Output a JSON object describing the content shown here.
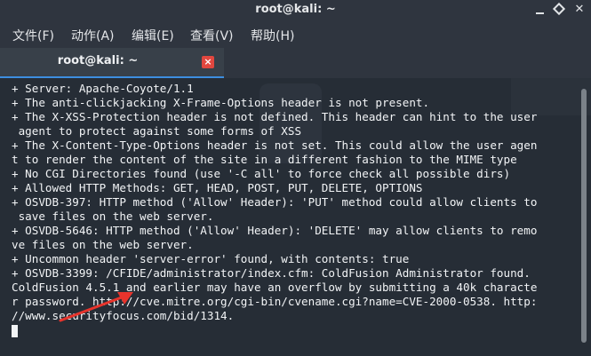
{
  "window": {
    "title": "root@kali: ~"
  },
  "menu": [
    {
      "label": "文件(F)"
    },
    {
      "label": "动作(A)"
    },
    {
      "label": "编辑(E)"
    },
    {
      "label": "查看(V)"
    },
    {
      "label": "帮助(H)"
    }
  ],
  "tab": {
    "label": "root@kali: ~",
    "close_glyph": "×"
  },
  "terminal": {
    "lines": [
      "+ Server: Apache-Coyote/1.1",
      "+ The anti-clickjacking X-Frame-Options header is not present.",
      "+ The X-XSS-Protection header is not defined. This header can hint to the user",
      " agent to protect against some forms of XSS",
      "+ The X-Content-Type-Options header is not set. This could allow the user agen",
      "t to render the content of the site in a different fashion to the MIME type",
      "+ No CGI Directories found (use '-C all' to force check all possible dirs)",
      "+ Allowed HTTP Methods: GET, HEAD, POST, PUT, DELETE, OPTIONS",
      "+ OSVDB-397: HTTP method ('Allow' Header): 'PUT' method could allow clients to",
      " save files on the web server.",
      "+ OSVDB-5646: HTTP method ('Allow' Header): 'DELETE' may allow clients to remo",
      "ve files on the web server.",
      "+ Uncommon header 'server-error' found, with contents: true",
      "+ OSVDB-3399: /CFIDE/administrator/index.cfm: ColdFusion Administrator found.",
      "ColdFusion 4.5.1 and earlier may have an overflow by submitting a 40k characte",
      "r password. http://cve.mitre.org/cgi-bin/cvename.cgi?name=CVE-2000-0538. http:",
      "//www.securityfocus.com/bid/1314."
    ]
  },
  "colors": {
    "background": "#262d36",
    "chrome": "#2f353f",
    "tab_active": "#384049",
    "tab_underline": "#3d8ee0",
    "tab_close": "#e1473f",
    "text": "#f2f4f6",
    "annotation_arrow": "#e8342c"
  },
  "icons": {
    "minimize": "minimize-icon",
    "maximize": "maximize-icon",
    "close": "close-icon",
    "tab_close": "tab-close-icon",
    "annotation": "red-arrow-icon"
  }
}
